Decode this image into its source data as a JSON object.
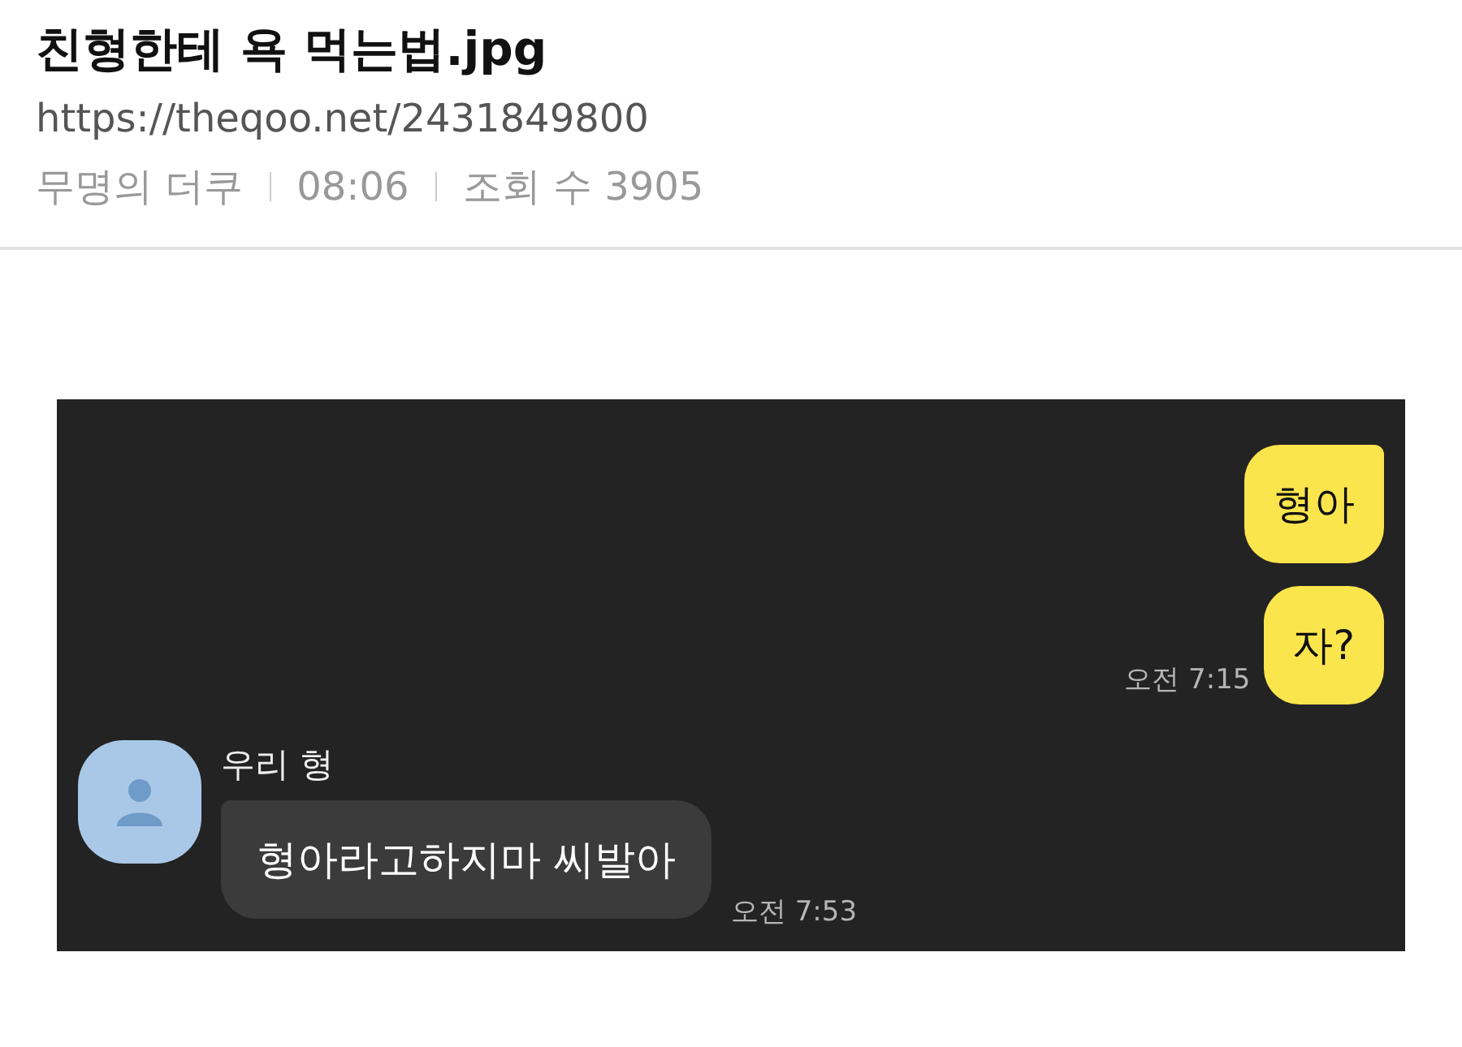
{
  "post": {
    "title": "친형한테 욕 먹는법.jpg",
    "url": "https://theqoo.net/2431849800",
    "author": "무명의 더쿠",
    "time": "08:06",
    "views": "조회 수 3905"
  },
  "chat": {
    "messages": [
      {
        "kind": "sent",
        "text": "형아",
        "tail": true
      },
      {
        "kind": "sent",
        "text": "자?",
        "tail": false,
        "time": "오전 7:15"
      },
      {
        "kind": "received",
        "sender": "우리 형",
        "text": "형아라고하지마 씨발아",
        "time": "오전 7:53"
      }
    ]
  }
}
